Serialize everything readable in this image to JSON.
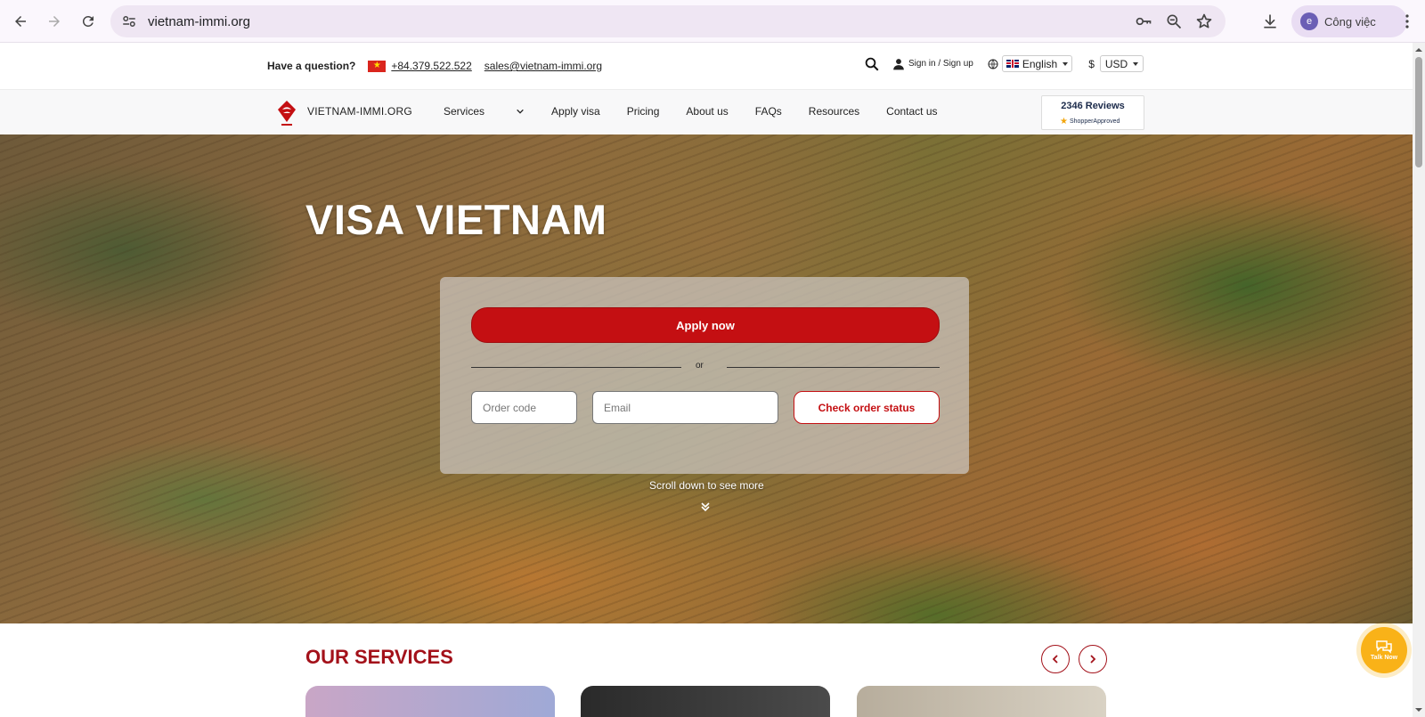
{
  "browser": {
    "url": "vietnam-immi.org",
    "profile_initial": "e",
    "profile_name": "Công việc"
  },
  "infobar": {
    "question": "Have a question?",
    "phone": "+84.379.522.522",
    "email": "sales@vietnam-immi.org",
    "signin": "Sign in / Sign up",
    "language": "English",
    "currency_symbol": "$",
    "currency": "USD"
  },
  "nav": {
    "brand": "VIETNAM-IMMI.ORG",
    "items": [
      "Services",
      "Apply visa",
      "Pricing",
      "About us",
      "FAQs",
      "Resources",
      "Contact us"
    ],
    "reviews_count": "2346 Reviews",
    "reviews_provider": "ShopperApproved"
  },
  "hero": {
    "title": "VISA VIETNAM",
    "apply_label": "Apply now",
    "or_label": "or",
    "order_code_placeholder": "Order code",
    "email_placeholder": "Email",
    "check_label": "Check order status",
    "scroll_hint": "Scroll down to see more"
  },
  "services": {
    "title": "OUR SERVICES"
  },
  "chat": {
    "label": "Talk Now"
  },
  "colors": {
    "brand_red": "#c40f12",
    "title_red": "#a3111a",
    "chat_yellow": "#f9b218"
  }
}
